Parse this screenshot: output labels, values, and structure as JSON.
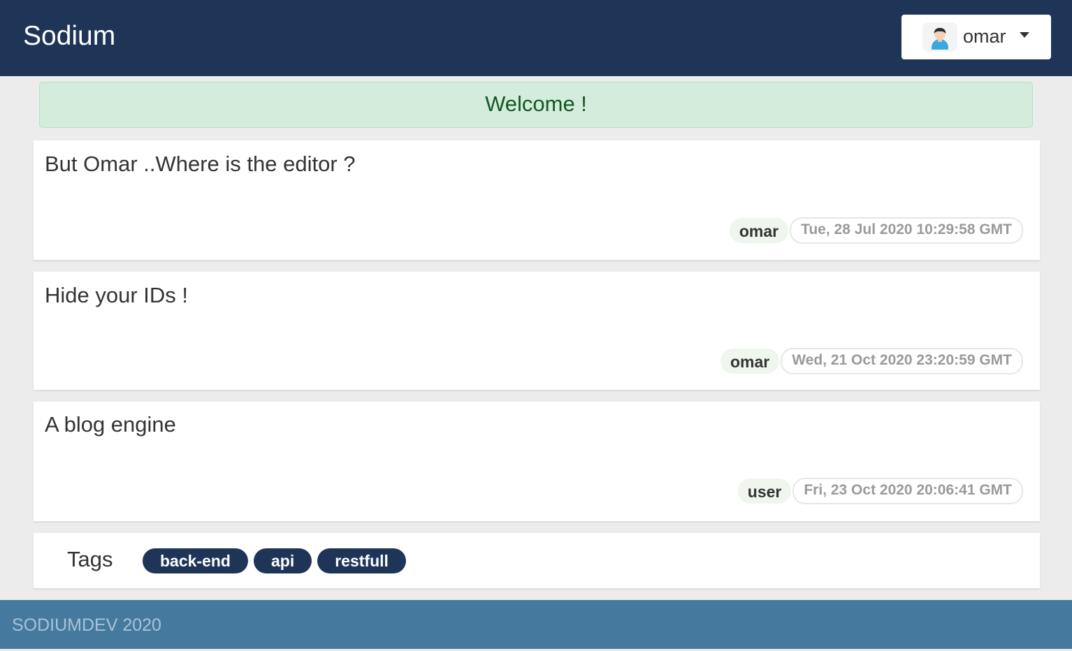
{
  "navbar": {
    "brand": "Sodium",
    "user": {
      "name": "omar",
      "avatar_icon": "user-avatar-icon"
    }
  },
  "alert": {
    "message": "Welcome !"
  },
  "posts": [
    {
      "title": "But Omar ..Where is the editor ?",
      "author": "omar",
      "date": "Tue, 28 Jul 2020 10:29:58 GMT"
    },
    {
      "title": "Hide your IDs !",
      "author": "omar",
      "date": "Wed, 21 Oct 2020 23:20:59 GMT"
    },
    {
      "title": "A blog engine",
      "author": "user",
      "date": "Fri, 23 Oct 2020 20:06:41 GMT"
    }
  ],
  "tags": {
    "label": "Tags",
    "items": [
      "back-end",
      "api",
      "restfull"
    ]
  },
  "footer": {
    "text": "SODIUMDEV 2020"
  },
  "colors": {
    "navbar": "#1f3557",
    "alert_bg": "#d4ecdc",
    "alert_text": "#155724",
    "tag_bg": "#1f3557",
    "footer": "#457a9e"
  }
}
